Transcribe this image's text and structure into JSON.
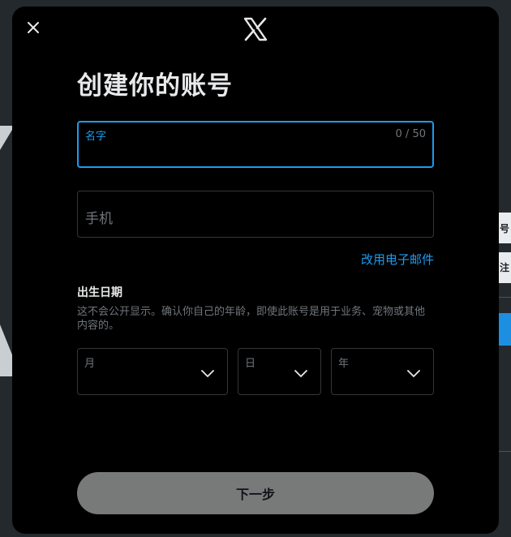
{
  "modal": {
    "close_icon": "close-icon",
    "logo_icon": "x-logo-icon",
    "title": "创建你的账号"
  },
  "name_field": {
    "label": "名字",
    "counter": "0 / 50",
    "value": ""
  },
  "phone_field": {
    "placeholder": "手机"
  },
  "switch_link": "改用电子邮件",
  "dob": {
    "title": "出生日期",
    "description": "这不会公开显示。确认你自己的年龄，即使此账号是用于业务、宠物或其他内容的。",
    "month_label": "月",
    "day_label": "日",
    "year_label": "年"
  },
  "next_button": "下一步",
  "background": {
    "glyph_1": "号",
    "glyph_2": "注"
  },
  "colors": {
    "accent": "#1d9bf0",
    "modal_bg": "#000000",
    "button_disabled": "#787a7a"
  }
}
